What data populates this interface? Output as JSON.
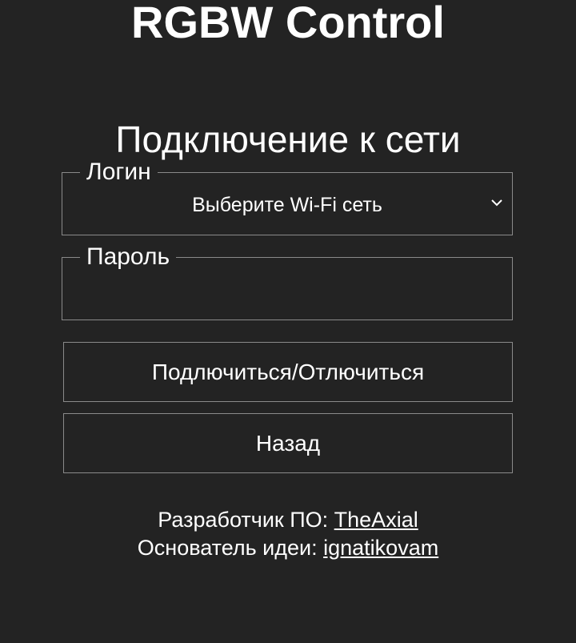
{
  "app": {
    "title": "RGBW Control"
  },
  "network": {
    "title": "Подключение к сети",
    "login_label": "Логин",
    "ssid_select_value": "Выберите Wi-Fi сеть",
    "password_label": "Пароль",
    "password_value": ""
  },
  "buttons": {
    "connect_label": "Подлючиться/Отлючиться",
    "back_label": "Назад"
  },
  "credits": {
    "developer_label": "Разработчик ПО: ",
    "developer_link": "TheAxial",
    "founder_label": "Основатель идеи: ",
    "founder_link": "ignatikovam"
  },
  "colors": {
    "background": "#232323",
    "text": "#ffffff",
    "border": "#8a8a8a"
  },
  "icons": {
    "dropdown": "chevron-down-icon"
  }
}
